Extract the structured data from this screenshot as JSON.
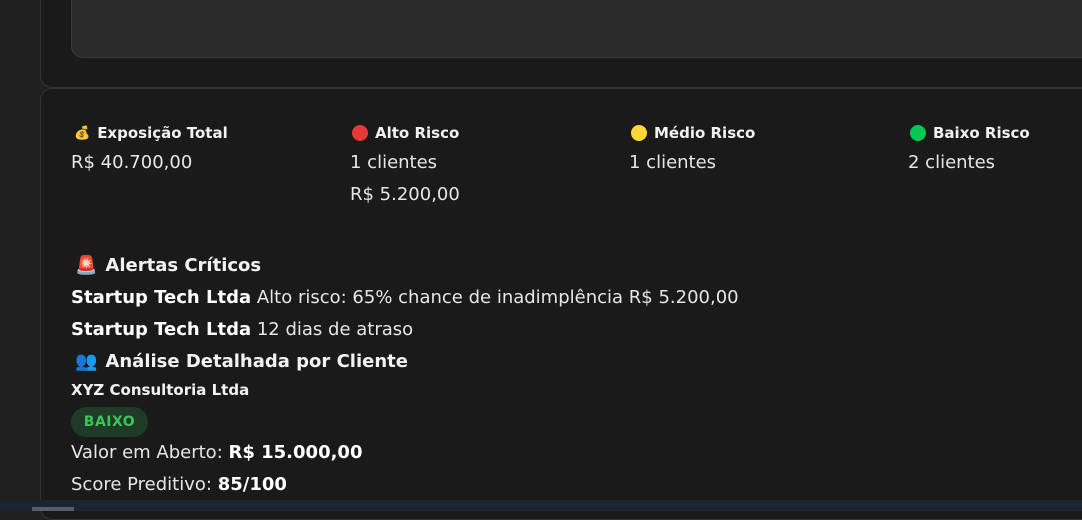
{
  "top_panel": {
    "legend_colors": [
      "#1a73e8",
      "#34a853"
    ]
  },
  "summary": {
    "total": {
      "icon": "money-bag-icon",
      "label": "Exposição Total",
      "value": "R$ 40.700,00"
    },
    "high": {
      "color": "#e53935",
      "label": "Alto Risco",
      "clients": "1 clientes",
      "amount": "R$ 5.200,00"
    },
    "medium": {
      "color": "#fdd835",
      "label": "Médio Risco",
      "clients": "1 clientes"
    },
    "low": {
      "color": "#00c853",
      "label": "Baixo Risco",
      "clients": "2 clientes"
    }
  },
  "alerts": {
    "icon": "siren-icon",
    "title": "Alertas Críticos",
    "items": [
      {
        "client": "Startup Tech Ltda",
        "text": " Alto risco: 65% chance de inadimplência R$ 5.200,00"
      },
      {
        "client": "Startup Tech Ltda",
        "text": " 12 dias de atraso"
      }
    ]
  },
  "analysis": {
    "icon": "people-icon",
    "title": "Análise Detalhada por Cliente",
    "client": {
      "name": "XYZ Consultoria Ltda",
      "risk_badge": "BAIXO",
      "open_label": "Valor em Aberto: ",
      "open_value": "R$ 15.000,00",
      "score_label": "Score Preditivo: ",
      "score_value": "85/100"
    }
  }
}
